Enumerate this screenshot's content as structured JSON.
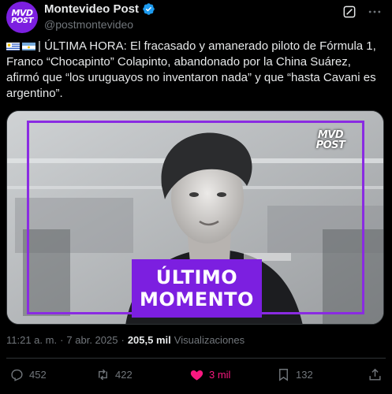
{
  "author": {
    "avatar_text_1": "MVD",
    "avatar_text_2": "POST",
    "display_name": "Montevideo Post",
    "handle": "@postmontevideo"
  },
  "tweet": {
    "flags": [
      "uruguay",
      "argentina"
    ],
    "text": "| ÚLTIMA HORA: El fracasado y amanerado piloto de Fórmula 1, Franco “Chocapinto” Colapinto, abandonado por la China Suárez, afirmó que “los uruguayos no inventaron nada” y que “hasta Cavani es argentino”."
  },
  "media": {
    "banner_line_1": "ÚLTIMO",
    "banner_line_2": "MOMENTO",
    "logo_line_1": "MVD",
    "logo_line_2": "POST",
    "brand_color": "#7c1fe0"
  },
  "meta": {
    "time": "11:21 a. m.",
    "separator": "·",
    "date": "7 abr. 2025",
    "views_count": "205,5 mil",
    "views_label": "Visualizaciones"
  },
  "actions": {
    "replies": "452",
    "reposts": "422",
    "likes": "3 mil",
    "bookmarks": "132"
  },
  "icons": [
    "verified-icon",
    "grok-icon",
    "more-icon",
    "reply-icon",
    "repost-icon",
    "like-icon",
    "bookmark-icon",
    "share-icon"
  ]
}
